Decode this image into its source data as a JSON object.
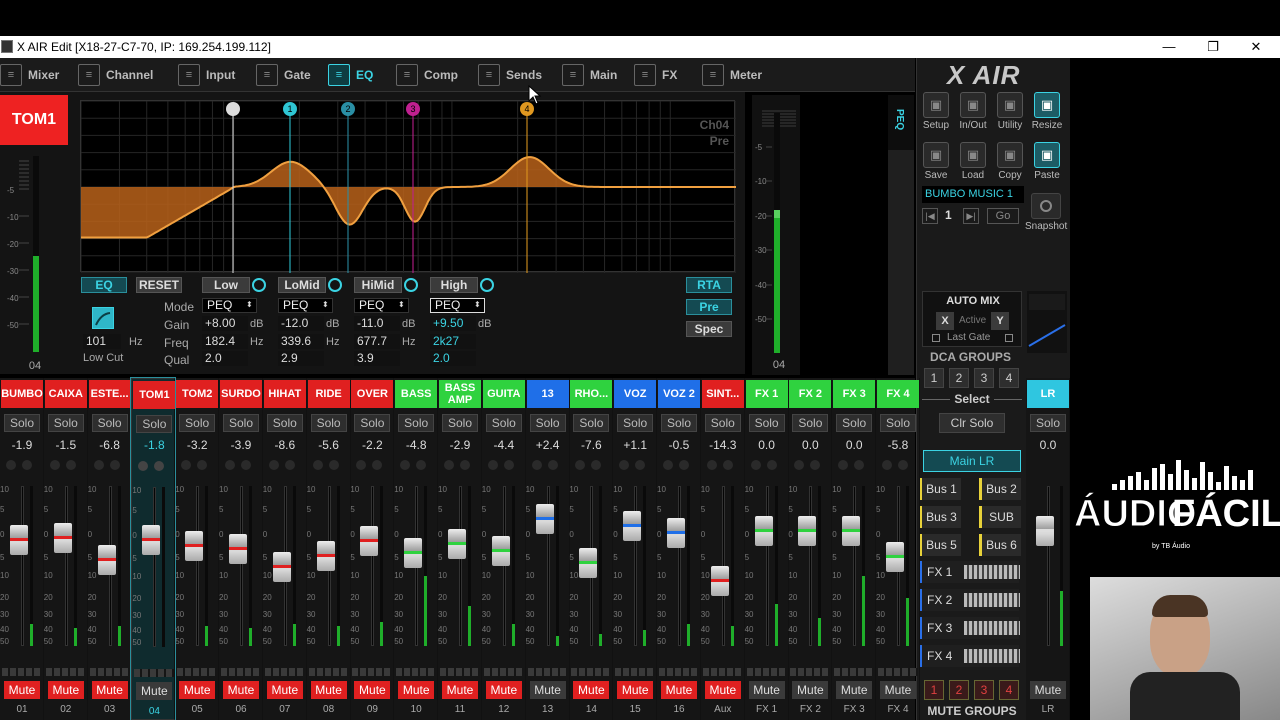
{
  "window": {
    "title": "X AIR Edit [X18-27-C7-70, IP: 169.254.199.112]",
    "minimize": "—",
    "restore": "❐",
    "close": "✕"
  },
  "nav": [
    {
      "label": "Mixer",
      "icon": "mixer-icon"
    },
    {
      "label": "Channel",
      "icon": "channel-icon"
    },
    {
      "label": "Input",
      "icon": "input-icon"
    },
    {
      "label": "Gate",
      "icon": "gate-icon"
    },
    {
      "label": "EQ",
      "icon": "eq-icon",
      "active": true
    },
    {
      "label": "Comp",
      "icon": "comp-icon"
    },
    {
      "label": "Sends",
      "icon": "sends-icon"
    },
    {
      "label": "Main",
      "icon": "main-icon"
    },
    {
      "label": "FX",
      "icon": "fx-icon"
    },
    {
      "label": "Meter",
      "icon": "meter-icon"
    }
  ],
  "channel": {
    "name": "TOM1",
    "number": "04"
  },
  "eq": {
    "graph_label1": "Ch04",
    "graph_label2": "Pre",
    "band_markers": [
      "",
      "1",
      "2",
      "3",
      "4"
    ],
    "eq_button": "EQ",
    "reset_button": "RESET",
    "lowcut_freq": "101",
    "lowcut_unit": "Hz",
    "lowcut_label": "Low Cut",
    "row_labels": {
      "mode": "Mode",
      "gain": "Gain",
      "freq": "Freq",
      "qual": "Qual"
    },
    "bands": [
      {
        "name": "Low",
        "mode": "PEQ",
        "gain": "+8.00",
        "gain_unit": "dB",
        "freq": "182.4",
        "freq_unit": "Hz",
        "q": "2.0"
      },
      {
        "name": "LoMid",
        "mode": "PEQ",
        "gain": "-12.0",
        "gain_unit": "dB",
        "freq": "339.6",
        "freq_unit": "Hz",
        "q": "2.9"
      },
      {
        "name": "HiMid",
        "mode": "PEQ",
        "gain": "-11.0",
        "gain_unit": "dB",
        "freq": "677.7",
        "freq_unit": "Hz",
        "q": "3.9"
      },
      {
        "name": "High",
        "mode": "PEQ",
        "gain": "+9.50",
        "gain_unit": "dB",
        "freq": "2k27",
        "freq_unit": "",
        "q": "2.0"
      }
    ],
    "rta": "RTA",
    "pre": "Pre",
    "spec": "Spec",
    "peq": "PEQ",
    "meter_scale": [
      "-5",
      "-10",
      "-20",
      "-30",
      "-40",
      "-50"
    ]
  },
  "right": {
    "logo": "X AIR",
    "buttons": [
      {
        "label": "Setup",
        "icon": "gear-icon"
      },
      {
        "label": "In/Out",
        "icon": "inout-icon"
      },
      {
        "label": "Utility",
        "icon": "wrench-icon"
      },
      {
        "label": "Resize",
        "icon": "resize-icon",
        "on": true
      },
      {
        "label": "Save",
        "icon": "save-icon"
      },
      {
        "label": "Load",
        "icon": "folder-icon"
      },
      {
        "label": "Copy",
        "icon": "copy-icon"
      },
      {
        "label": "Paste",
        "icon": "paste-icon",
        "on": true
      }
    ],
    "snapshot_name": "BUMBO MUSIC 1",
    "snapshot_num": "1",
    "go": "Go",
    "snapshot": "Snapshot",
    "automix": "AUTO MIX",
    "am_x": "X",
    "am_active": "Active",
    "am_y": "Y",
    "am_lastgate": "Last Gate",
    "dca_title": "DCA GROUPS",
    "dca": [
      "1",
      "2",
      "3",
      "4"
    ],
    "select": "Select",
    "clr_solo": "Clr Solo",
    "main_lr": "Main LR",
    "bus": [
      "Bus 1",
      "Bus 2",
      "Bus 3",
      "SUB",
      "Bus 5",
      "Bus 6"
    ],
    "fx": [
      "FX 1",
      "FX 2",
      "FX 3",
      "FX 4"
    ],
    "mute_groups": [
      "1",
      "2",
      "3",
      "4"
    ],
    "mute_groups_label": "MUTE GROUPS"
  },
  "lr": {
    "name": "LR",
    "solo": "Solo",
    "db": "0.0",
    "mute": "Mute",
    "num": "LR"
  },
  "solo_label": "Solo",
  "mute_label": "Mute",
  "strips": [
    {
      "name": "BUMBO",
      "db": "-1.9",
      "num": "01",
      "color": "#e02020",
      "fader": -1.9,
      "cap": "#e02020",
      "muted": true
    },
    {
      "name": "CAIXA",
      "db": "-1.5",
      "num": "02",
      "color": "#e02020",
      "fader": -1.5,
      "cap": "#e02020",
      "muted": true
    },
    {
      "name": "ESTE...",
      "db": "-6.8",
      "num": "03",
      "color": "#e02020",
      "fader": -6.8,
      "cap": "#e02020",
      "muted": true
    },
    {
      "name": "TOM1",
      "db": "-1.8",
      "num": "04",
      "color": "#e02020",
      "fader": -1.8,
      "cap": "#e02020",
      "muted": false,
      "selected": true
    },
    {
      "name": "TOM2",
      "db": "-3.2",
      "num": "05",
      "color": "#e02020",
      "fader": -3.2,
      "cap": "#e02020",
      "muted": true
    },
    {
      "name": "SURDO",
      "db": "-3.9",
      "num": "06",
      "color": "#e02020",
      "fader": -3.9,
      "cap": "#e02020",
      "muted": true
    },
    {
      "name": "HIHAT",
      "db": "-8.6",
      "num": "07",
      "color": "#e02020",
      "fader": -8.6,
      "cap": "#e02020",
      "muted": true
    },
    {
      "name": "RIDE",
      "db": "-5.6",
      "num": "08",
      "color": "#e02020",
      "fader": -5.6,
      "cap": "#e02020",
      "muted": true
    },
    {
      "name": "OVER",
      "db": "-2.2",
      "num": "09",
      "color": "#e02020",
      "fader": -2.2,
      "cap": "#e02020",
      "muted": true
    },
    {
      "name": "BASS",
      "db": "-4.8",
      "num": "10",
      "color": "#2fd23f",
      "fader": -4.8,
      "cap": "#2fd23f",
      "muted": true
    },
    {
      "name": "BASS AMP",
      "db": "-2.9",
      "num": "11",
      "color": "#2fd23f",
      "fader": -2.9,
      "cap": "#2fd23f",
      "muted": true,
      "two": true
    },
    {
      "name": "GUITA",
      "db": "-4.4",
      "num": "12",
      "color": "#2fd23f",
      "fader": -4.4,
      "cap": "#2fd23f",
      "muted": true
    },
    {
      "name": "13",
      "db": "+2.4",
      "num": "13",
      "color": "#1f6fe8",
      "fader": 2.4,
      "cap": "#1f6fe8",
      "muted": false
    },
    {
      "name": "RHO...",
      "db": "-7.6",
      "num": "14",
      "color": "#2fd23f",
      "fader": -7.6,
      "cap": "#2fd23f",
      "muted": true
    },
    {
      "name": "VOZ",
      "db": "+1.1",
      "num": "15",
      "color": "#1f6fe8",
      "fader": 1.1,
      "cap": "#1f6fe8",
      "muted": true
    },
    {
      "name": "VOZ 2",
      "db": "-0.5",
      "num": "16",
      "color": "#1f6fe8",
      "fader": -0.5,
      "cap": "#1f6fe8",
      "muted": true
    },
    {
      "name": "SINT...",
      "db": "-14.3",
      "num": "Aux",
      "color": "#e02020",
      "fader": -14.3,
      "cap": "#e02020",
      "muted": true
    },
    {
      "name": "FX 1",
      "db": "0.0",
      "num": "FX 1",
      "color": "#2fd23f",
      "fader": 0.0,
      "cap": "#2fd23f",
      "muted": false
    },
    {
      "name": "FX 2",
      "db": "0.0",
      "num": "FX 2",
      "color": "#2fd23f",
      "fader": 0.0,
      "cap": "#2fd23f",
      "muted": false
    },
    {
      "name": "FX 3",
      "db": "0.0",
      "num": "FX 3",
      "color": "#2fd23f",
      "fader": 0.0,
      "cap": "#2fd23f",
      "muted": false
    },
    {
      "name": "FX 4",
      "db": "-5.8",
      "num": "FX 4",
      "color": "#2fd23f",
      "fader": -5.8,
      "cap": "#2fd23f",
      "muted": false
    }
  ],
  "fader_scale": [
    "10",
    "5",
    "0",
    "5",
    "10",
    "20",
    "30",
    "40",
    "50"
  ],
  "watermark": {
    "line1": "ÁUDIO",
    "line2": "FÁCIL",
    "by": "by TB Áudio"
  },
  "colors": {
    "accent": "#3bd3e3",
    "eq_fill": "#b8621a",
    "eq_line": "#f0a040"
  }
}
